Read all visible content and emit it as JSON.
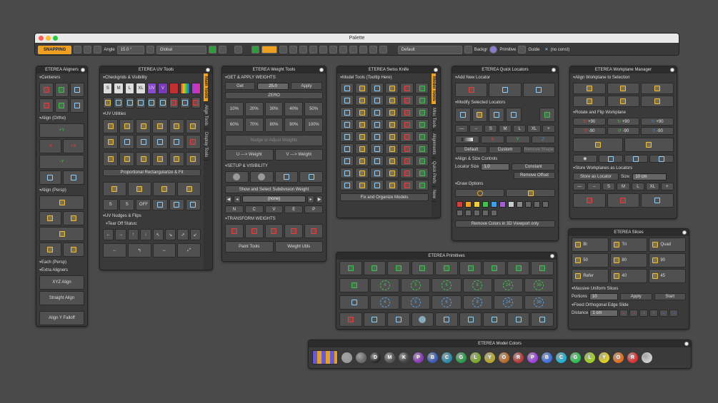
{
  "palette": {
    "title": "Palette",
    "snapping": "SNAPPING",
    "angle_label": "Angle",
    "angle_value": "15.0 °",
    "global_select": "Global",
    "default_select": "Default",
    "backgr": "Backgr",
    "primitive": "Primitive",
    "guide": "Guide",
    "no_const": "(no const)"
  },
  "aligners": {
    "title": "ETEREA Aligners",
    "s1": "Centerers",
    "s2": "Align (Ortho)",
    "plus_y": "+Y",
    "minus_x": "-X",
    "plus_x": "+X",
    "minus_y": "-Y",
    "s3": "Align (Persp)",
    "s4": "Each (Persp)",
    "s5": "Extra Aligners",
    "xyz": "XYZ Align",
    "straight": "Straight Align",
    "falloff": "Align Y Falloff"
  },
  "uv": {
    "title": "ETEREA UV Tools",
    "s1": "Checkgrids & Visibility",
    "checks": [
      "S",
      "M",
      "L",
      "XL",
      "UV",
      "V"
    ],
    "s2": "UV Utilities",
    "prop": "Proportional Rectangularize & Fit",
    "s3": "UV Nudges & Flips",
    "tearoff": "Tear Off Status:",
    "off": "OFF",
    "tabs": [
      "Main Tools",
      "Align Tools",
      "Display Tools"
    ]
  },
  "weight": {
    "title": "ETEREA Weight Tools",
    "s1": "GET & APPLY WEIGHTS",
    "get": "Get",
    "value": "25.0",
    "apply": "Apply",
    "zero": "ZERO",
    "row1": [
      "10%",
      "20%",
      "30%",
      "40%",
      "50%"
    ],
    "row2": [
      "60%",
      "70%",
      "80%",
      "90%",
      "100%"
    ],
    "nudge": "Nudge or Adjust Weights",
    "u_weight": "U ---> Weight",
    "v_weight": "V ---> Weight",
    "s2": "SETUP & VISIBILITY",
    "show_sel": "Show and Select Subdivision Weight",
    "none": "(none)",
    "s3": "TRANSFORM WEIGHTS",
    "paint": "Paint Tools",
    "utils": "Weight Utils"
  },
  "swiss": {
    "title": "ETEREA Swiss Knife",
    "s1": "Model Tools (Tooltip Here)",
    "fix": "Fix and Organize Models",
    "tabs": [
      "Model Tools",
      "Misc Tools",
      "Alignments",
      "Quick Prefs",
      "New"
    ]
  },
  "locators": {
    "title": "ETEREA Quick Locators",
    "s1": "Add New Locator",
    "s2": "Modify Selected Locators",
    "sizes": [
      "S",
      "M",
      "L",
      "XL"
    ],
    "axes": [
      "X",
      "Y",
      "Z"
    ],
    "default": "Default",
    "custom": "Custom",
    "remove_shape": "Remove Shape",
    "s3": "Align & Size Controls",
    "loc_size": "Locator Size",
    "loc_value": "1.0",
    "constant": "Constant",
    "remove_offset": "Remove Offset",
    "s4": "Draw Options",
    "remove_colors": "Remove Colors in 3D Viewport only",
    "colors": [
      "#d04040",
      "#f0a020",
      "#f0d040",
      "#40c050",
      "#40a0e0",
      "#a060d0",
      "#cccccc",
      "#888888"
    ]
  },
  "workplane": {
    "title": "ETEREA Workplane Manager",
    "s1": "Align Workplane to Selection",
    "s2": "Rotate and Flip Workplane",
    "r1": [
      "+90",
      "+90",
      "+90"
    ],
    "r2": [
      "-90",
      "-90",
      "-90"
    ],
    "s3": "Store Workplanes as Locators",
    "store": "Store as Locator",
    "size_lbl": "Size:",
    "size_val": "10 cm",
    "sizes": [
      "S",
      "M",
      "L",
      "XL"
    ]
  },
  "slices": {
    "title": "ETEREA Slices",
    "b": [
      "Bi",
      "Tri",
      "Quad",
      "50",
      "80",
      "90",
      "Refer",
      "40",
      "45"
    ],
    "s1": "Massive Uniform Slices",
    "portions": "Portions",
    "p_val": "10",
    "apply": "Apply",
    "start": "Start",
    "s2": "Fixed Orthogonal Edge Slide",
    "distance": "Distance",
    "d_val": "1 cm"
  },
  "primitives": {
    "title": "ETEREA Primitives",
    "nums": [
      "4",
      "5",
      "6",
      "8",
      "24",
      "36",
      "4",
      "5",
      "6",
      "8",
      "24",
      "36"
    ]
  },
  "colors": {
    "title": "ETEREA Model Colors",
    "letters": [
      "",
      "",
      "D",
      "M",
      "K",
      "P",
      "B",
      "C",
      "G",
      "L",
      "Y",
      "O",
      "R",
      "P",
      "B",
      "C",
      "G",
      "L",
      "Y",
      "O",
      "R",
      ""
    ],
    "hex": [
      "#9a9a9a",
      "#6a6a6a",
      "#2a2a2a",
      "#555555",
      "#444444",
      "#8a3ab8",
      "#3a5ab8",
      "#2a8aa8",
      "#2a9a4a",
      "#7aa82a",
      "#b8a82a",
      "#b86a2a",
      "#b83a3a",
      "#a040e0",
      "#4070e0",
      "#20b0d0",
      "#30c050",
      "#a0d020",
      "#e0d020",
      "#e07020",
      "#e03030",
      "#cccccc"
    ]
  }
}
